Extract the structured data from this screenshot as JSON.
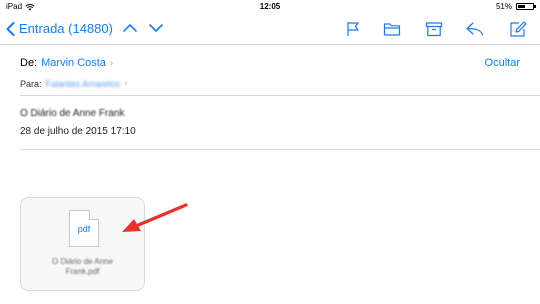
{
  "status_bar": {
    "device": "iPad",
    "time": "12:05",
    "battery": "51%",
    "battery_level": 0.51
  },
  "navbar": {
    "back_label": "Entrada (14880)",
    "icons": [
      "chevron-left-icon",
      "chevron-up-icon",
      "chevron-down-icon",
      "flag-icon",
      "folder-icon",
      "archive-icon",
      "reply-icon",
      "compose-icon"
    ]
  },
  "message": {
    "from_label": "De:",
    "from_name": "Marvin Costa",
    "hide_label": "Ocultar",
    "to_label": "Para:",
    "to_value": "Falantes Amarelos",
    "subject": "O Diário de Anne Frank",
    "date": "28 de julho de 2015 17:10"
  },
  "attachment": {
    "ext": "pdf",
    "name_line1": "O Diário de Anne",
    "name_line2": "Frank.pdf"
  },
  "colors": {
    "accent": "#1a7cf3",
    "annotation_arrow": "#e8312a"
  }
}
